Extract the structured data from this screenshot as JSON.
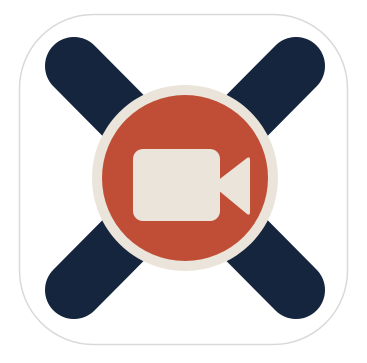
{
  "app_icon": {
    "icon_name": "video-camera-x-icon",
    "colors": {
      "background": "#ffffff",
      "tile": "#ffffff",
      "tile_border": "#d9d9d9",
      "x_mark": "#14253d",
      "circle_ring": "#ebe4da",
      "circle_fill": "#c04e36",
      "camera": "#ebe4da"
    }
  }
}
